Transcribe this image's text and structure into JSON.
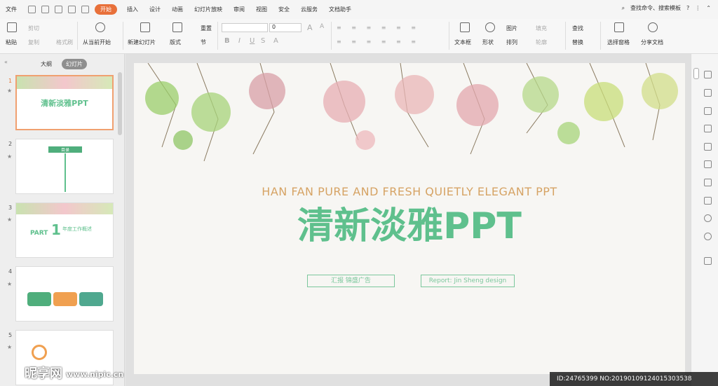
{
  "menu": {
    "file": "文件",
    "tabs": [
      "开始",
      "插入",
      "设计",
      "动画",
      "幻灯片放映",
      "审阅",
      "视图",
      "安全",
      "云服务",
      "文档助手"
    ],
    "search": "查找命令、搜索模板"
  },
  "ribbon": {
    "paste": "粘贴",
    "cut": "剪切",
    "copy": "复制",
    "format_painter": "格式刷",
    "from_current": "从当前开始",
    "new_slide": "新建幻灯片",
    "layout": "版式",
    "reset": "重置",
    "section": "节",
    "font_size": "0",
    "textbox": "文本框",
    "shape": "形状",
    "picture": "图片",
    "arrange": "排列",
    "fill": "填充",
    "outline": "轮廓",
    "find": "查找",
    "replace": "替换",
    "select_pane": "选择窗格",
    "share": "分享文档"
  },
  "left": {
    "tabs": [
      "大纲",
      "幻灯片"
    ],
    "slides": [
      "1",
      "2",
      "3",
      "4",
      "5"
    ],
    "thumb1_title": "清新淡雅PPT",
    "thumb2_title": "目录",
    "thumb3_part": "PART",
    "thumb3_num": "1",
    "thumb3_title": "年度工作概述"
  },
  "slide": {
    "subtitle": "HAN FAN PURE AND FRESH QUIETLY ELEGANT PPT",
    "title": "清新淡雅PPT",
    "box1": "汇报 锦盛广告",
    "box2": "Report: Jin Sheng design"
  },
  "watermark": {
    "site1": "昵享网",
    "site2": "www.nipic.cn",
    "id": "ID:24765399 NO:20190109124015303538"
  }
}
